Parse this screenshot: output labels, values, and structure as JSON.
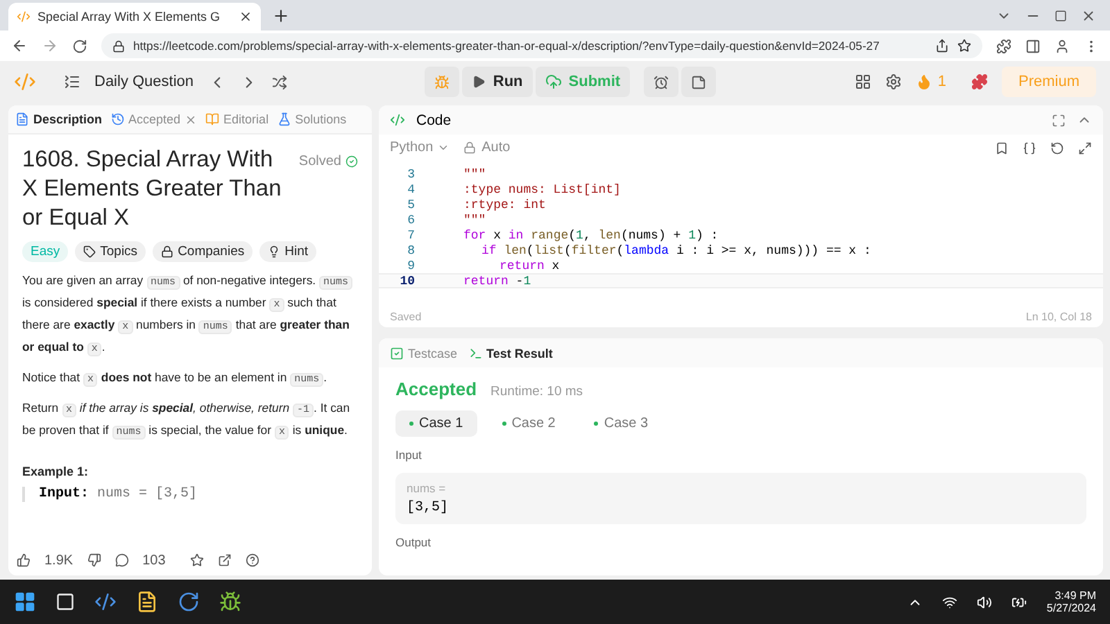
{
  "browser": {
    "tab_title": "Special Array With X Elements G",
    "url": "https://leetcode.com/problems/special-array-with-x-elements-greater-than-or-equal-x/description/?envType=daily-question&envId=2024-05-27"
  },
  "header": {
    "list_label": "Daily Question",
    "run": "Run",
    "submit": "Submit",
    "streak": "1",
    "premium": "Premium"
  },
  "left_tabs": [
    {
      "label": "Description",
      "selected": true,
      "closable": false
    },
    {
      "label": "Accepted",
      "selected": false,
      "closable": true
    },
    {
      "label": "Editorial",
      "selected": false,
      "closable": false
    },
    {
      "label": "Solutions",
      "selected": false,
      "closable": false
    }
  ],
  "problem": {
    "title": "1608. Special Array With X Elements Greater Than or Equal X",
    "status": "Solved",
    "difficulty": "Easy",
    "tags": [
      "Topics",
      "Companies",
      "Hint"
    ],
    "paragraphs": [
      [
        {
          "kind": "text",
          "text": "You are given an array "
        },
        {
          "kind": "code",
          "text": "nums"
        },
        {
          "kind": "text",
          "text": " of non-negative integers. "
        },
        {
          "kind": "code",
          "text": "nums"
        },
        {
          "kind": "text",
          "text": " is considered **special** if there exists a number "
        },
        {
          "kind": "code",
          "text": "x"
        },
        {
          "kind": "text",
          "text": " such that there are **exactly** "
        },
        {
          "kind": "code",
          "text": "x"
        },
        {
          "kind": "text",
          "text": " numbers in "
        },
        {
          "kind": "code",
          "text": "nums"
        },
        {
          "kind": "text",
          "text": " that are **greater than or equal to** "
        },
        {
          "kind": "code",
          "text": "x"
        },
        {
          "kind": "text",
          "text": "."
        }
      ],
      [
        {
          "kind": "text",
          "text": "Notice that "
        },
        {
          "kind": "code",
          "text": "x"
        },
        {
          "kind": "text",
          "text": " **does not** have to be an element in "
        },
        {
          "kind": "code",
          "text": "nums"
        },
        {
          "kind": "text",
          "text": "."
        }
      ],
      [
        {
          "kind": "text",
          "text": "Return "
        },
        {
          "kind": "code",
          "text": "x"
        },
        {
          "kind": "italic",
          "text": " if the array is **special**, otherwise, return "
        },
        {
          "kind": "code",
          "text": "-1"
        },
        {
          "kind": "text",
          "text": ". It can be proven that if "
        },
        {
          "kind": "code",
          "text": "nums"
        },
        {
          "kind": "text",
          "text": " is special, the value for "
        },
        {
          "kind": "code",
          "text": "x"
        },
        {
          "kind": "text",
          "text": " is **unique**."
        }
      ]
    ],
    "example_title": "Example 1:",
    "example_label": "Input:",
    "example_value": "nums = [3,5]"
  },
  "footer": {
    "likes": "1.9K",
    "comments": "103"
  },
  "code_panel": {
    "title": "Code",
    "language": "Python",
    "mode": "Auto",
    "status": "Saved",
    "cursor": "Ln 10, Col 18",
    "lines": [
      {
        "number": "3",
        "current": false,
        "tokens": [
          {
            "kind": "string",
            "text": "\"\"\""
          }
        ]
      },
      {
        "number": "4",
        "current": false,
        "tokens": [
          {
            "kind": "string",
            "text": ":type nums: List[int]"
          }
        ]
      },
      {
        "number": "5",
        "current": false,
        "tokens": [
          {
            "kind": "string",
            "text": ":rtype: int"
          }
        ]
      },
      {
        "number": "6",
        "current": false,
        "tokens": [
          {
            "kind": "string",
            "text": "\"\"\""
          }
        ]
      },
      {
        "number": "7",
        "current": false,
        "tokens": [
          {
            "kind": "keyword",
            "text": "for"
          },
          {
            "kind": "plain",
            "text": " x "
          },
          {
            "kind": "keyword",
            "text": "in"
          },
          {
            "kind": "func",
            "text": " range"
          },
          {
            "kind": "plain",
            "text": "("
          },
          {
            "kind": "number",
            "text": "1"
          },
          {
            "kind": "plain",
            "text": ", "
          },
          {
            "kind": "func",
            "text": "len"
          },
          {
            "kind": "plain",
            "text": "(nums) + "
          },
          {
            "kind": "number",
            "text": "1"
          },
          {
            "kind": "plain",
            "text": ") :"
          }
        ],
        "children": [
          {
            "number": "8",
            "current": false,
            "tokens": [
              {
                "kind": "keyword",
                "text": "if"
              },
              {
                "kind": "func",
                "text": " len"
              },
              {
                "kind": "plain",
                "text": "("
              },
              {
                "kind": "func",
                "text": "list"
              },
              {
                "kind": "plain",
                "text": "("
              },
              {
                "kind": "func",
                "text": "filter"
              },
              {
                "kind": "plain",
                "text": "("
              },
              {
                "kind": "lambda",
                "text": "lambda"
              },
              {
                "kind": "plain",
                "text": " i : i >= x, nums))) == x :"
              }
            ],
            "children": [
              {
                "number": "9",
                "current": false,
                "tokens": [
                  {
                    "kind": "keyword",
                    "text": "return"
                  },
                  {
                    "kind": "plain",
                    "text": " x"
                  }
                ]
              }
            ]
          }
        ]
      },
      {
        "number": "10",
        "current": true,
        "tokens": [
          {
            "kind": "keyword",
            "text": "return"
          },
          {
            "kind": "plain",
            "text": " -"
          },
          {
            "kind": "number",
            "text": "1"
          }
        ]
      }
    ]
  },
  "result_panel": {
    "tabs": [
      {
        "label": "Testcase",
        "selected": false
      },
      {
        "label": "Test Result",
        "selected": true
      }
    ],
    "verdict": "Accepted",
    "runtime": "Runtime: 10 ms",
    "cases": [
      {
        "label": "Case 1",
        "selected": true
      },
      {
        "label": "Case 2",
        "selected": false
      },
      {
        "label": "Case 3",
        "selected": false
      }
    ],
    "input_label": "Input",
    "input_name": "nums =",
    "input_value": "[3,5]",
    "output_label": "Output"
  },
  "taskbar": {
    "time": "3:49 PM",
    "date": "5/27/2024"
  }
}
